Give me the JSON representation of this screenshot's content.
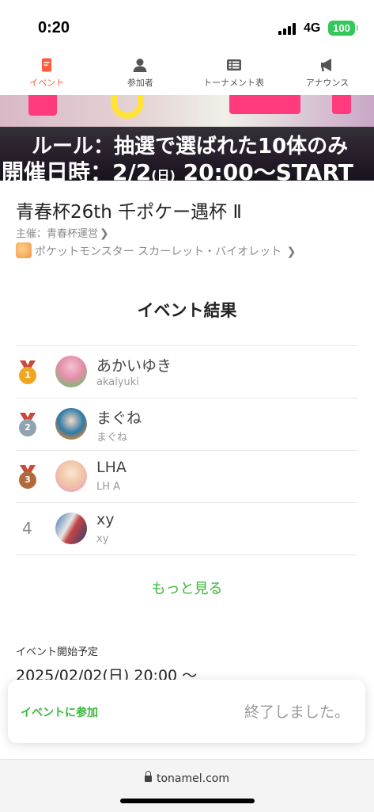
{
  "status_bar": {
    "time": "0:20",
    "network": "4G",
    "battery": "100"
  },
  "tabs": [
    {
      "label": "イベント",
      "icon": "event-doc-icon",
      "active": true
    },
    {
      "label": "参加者",
      "icon": "person-icon",
      "active": false
    },
    {
      "label": "トーナメント表",
      "icon": "bracket-icon",
      "active": false
    },
    {
      "label": "アナウンス",
      "icon": "megaphone-icon",
      "active": false
    }
  ],
  "banner": {
    "rule_line": "ルール：抽選で選ばれた10体のみ",
    "date_prefix": "開催日時：2/2",
    "date_day": "(日)",
    "date_suffix": " 20:00～START"
  },
  "event": {
    "title": "青春杯26th 千ポケー遇杯 Ⅱ",
    "organizer": "主催：青春杯運営",
    "game": "ポケットモンスター スカーレット・バイオレット"
  },
  "results": {
    "heading": "イベント結果",
    "rows": [
      {
        "rank": "1",
        "medal": "gold-medal-icon",
        "name": "あかいゆき",
        "username": "akaiyuki"
      },
      {
        "rank": "2",
        "medal": "silver-medal-icon",
        "name": "まぐね",
        "username": "まぐね"
      },
      {
        "rank": "3",
        "medal": "bronze-medal-icon",
        "name": "LHA",
        "username": "LH A"
      },
      {
        "rank": "4",
        "medal": null,
        "name": "xy",
        "username": "xy"
      }
    ],
    "more_label": "もっと見る"
  },
  "schedule": {
    "label": "イベント開始予定",
    "value": "2025/02/02(日) 20:00 〜"
  },
  "join_card": {
    "join_label": "イベントに参加",
    "status": "終了しました。"
  },
  "browser": {
    "url": "tonamel.com"
  },
  "colors": {
    "accent": "#ff5a3c",
    "green": "#3cb63c",
    "gold": "#f0a623",
    "silver": "#8fa3b3",
    "bronze": "#b06a3b"
  }
}
